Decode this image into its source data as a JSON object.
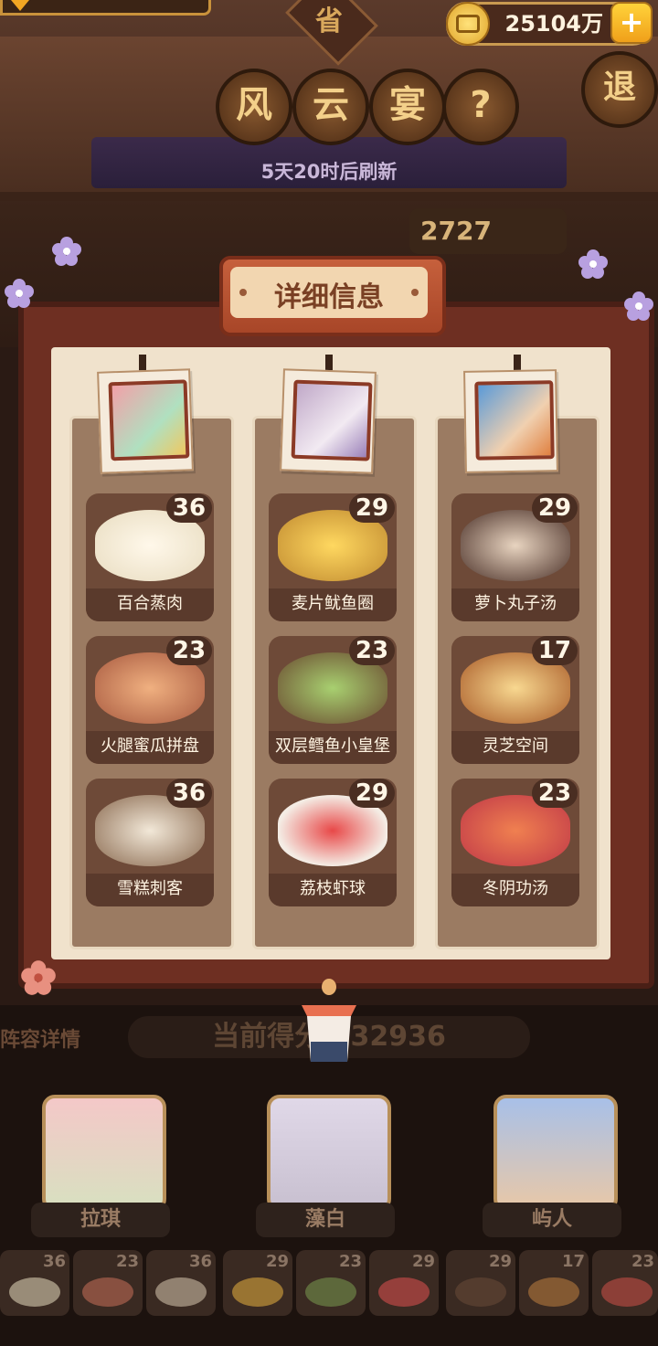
{
  "hud": {
    "coin_amount": "25104万",
    "plus_label": "+",
    "sheng": "省"
  },
  "title_buttons": [
    "风",
    "云",
    "宴"
  ],
  "help_label": "?",
  "exit_label": "退",
  "refresh_text": "5天20时后刷新",
  "top_score": "2727",
  "panel": {
    "title": "详细信息"
  },
  "columns": [
    {
      "dishes": [
        {
          "name": "百合蒸肉",
          "score": "36",
          "color": "#e8dcc0"
        },
        {
          "name": "火腿蜜瓜拼盘",
          "score": "23",
          "color": "#c8705a"
        },
        {
          "name": "雪糕刺客",
          "score": "36",
          "color": "#d9c8b0"
        }
      ]
    },
    {
      "dishes": [
        {
          "name": "麦片鱿鱼圈",
          "score": "29",
          "color": "#e8b040"
        },
        {
          "name": "双层鳕鱼小皇堡",
          "score": "23",
          "color": "#7a9a50"
        },
        {
          "name": "荔枝虾球",
          "score": "29",
          "color": "#e05050"
        }
      ]
    },
    {
      "dishes": [
        {
          "name": "萝卜丸子汤",
          "score": "29",
          "color": "#6a4a38"
        },
        {
          "name": "灵芝空间",
          "score": "17",
          "color": "#c08040"
        },
        {
          "name": "冬阴功汤",
          "score": "23",
          "color": "#d05048"
        }
      ]
    }
  ],
  "bottom": {
    "lineup_label": "阵容详情",
    "current_score": "当前得分 432936",
    "characters": [
      "拉琪",
      "藻白",
      "屿人"
    ],
    "mini_scores": [
      "36",
      "23",
      "36",
      "29",
      "23",
      "29",
      "29",
      "17",
      "23"
    ]
  },
  "colors": {
    "portrait1": "#f2a0a8",
    "portrait2": "#d8d0e0",
    "portrait3": "#6a8fd0"
  }
}
